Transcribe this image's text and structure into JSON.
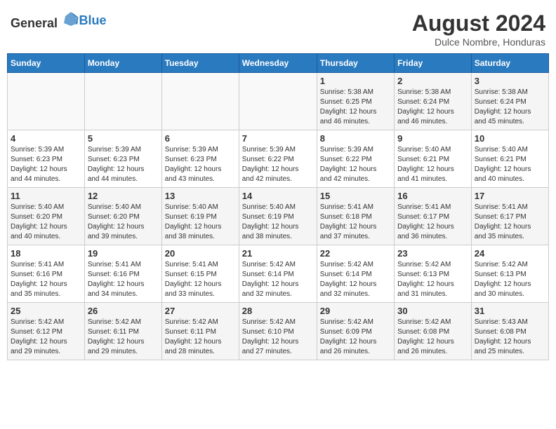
{
  "header": {
    "logo_general": "General",
    "logo_blue": "Blue",
    "month_year": "August 2024",
    "location": "Dulce Nombre, Honduras"
  },
  "days_of_week": [
    "Sunday",
    "Monday",
    "Tuesday",
    "Wednesday",
    "Thursday",
    "Friday",
    "Saturday"
  ],
  "weeks": [
    [
      {
        "day": "",
        "info": ""
      },
      {
        "day": "",
        "info": ""
      },
      {
        "day": "",
        "info": ""
      },
      {
        "day": "",
        "info": ""
      },
      {
        "day": "1",
        "info": "Sunrise: 5:38 AM\nSunset: 6:25 PM\nDaylight: 12 hours\nand 46 minutes."
      },
      {
        "day": "2",
        "info": "Sunrise: 5:38 AM\nSunset: 6:24 PM\nDaylight: 12 hours\nand 46 minutes."
      },
      {
        "day": "3",
        "info": "Sunrise: 5:38 AM\nSunset: 6:24 PM\nDaylight: 12 hours\nand 45 minutes."
      }
    ],
    [
      {
        "day": "4",
        "info": "Sunrise: 5:39 AM\nSunset: 6:23 PM\nDaylight: 12 hours\nand 44 minutes."
      },
      {
        "day": "5",
        "info": "Sunrise: 5:39 AM\nSunset: 6:23 PM\nDaylight: 12 hours\nand 44 minutes."
      },
      {
        "day": "6",
        "info": "Sunrise: 5:39 AM\nSunset: 6:23 PM\nDaylight: 12 hours\nand 43 minutes."
      },
      {
        "day": "7",
        "info": "Sunrise: 5:39 AM\nSunset: 6:22 PM\nDaylight: 12 hours\nand 42 minutes."
      },
      {
        "day": "8",
        "info": "Sunrise: 5:39 AM\nSunset: 6:22 PM\nDaylight: 12 hours\nand 42 minutes."
      },
      {
        "day": "9",
        "info": "Sunrise: 5:40 AM\nSunset: 6:21 PM\nDaylight: 12 hours\nand 41 minutes."
      },
      {
        "day": "10",
        "info": "Sunrise: 5:40 AM\nSunset: 6:21 PM\nDaylight: 12 hours\nand 40 minutes."
      }
    ],
    [
      {
        "day": "11",
        "info": "Sunrise: 5:40 AM\nSunset: 6:20 PM\nDaylight: 12 hours\nand 40 minutes."
      },
      {
        "day": "12",
        "info": "Sunrise: 5:40 AM\nSunset: 6:20 PM\nDaylight: 12 hours\nand 39 minutes."
      },
      {
        "day": "13",
        "info": "Sunrise: 5:40 AM\nSunset: 6:19 PM\nDaylight: 12 hours\nand 38 minutes."
      },
      {
        "day": "14",
        "info": "Sunrise: 5:40 AM\nSunset: 6:19 PM\nDaylight: 12 hours\nand 38 minutes."
      },
      {
        "day": "15",
        "info": "Sunrise: 5:41 AM\nSunset: 6:18 PM\nDaylight: 12 hours\nand 37 minutes."
      },
      {
        "day": "16",
        "info": "Sunrise: 5:41 AM\nSunset: 6:17 PM\nDaylight: 12 hours\nand 36 minutes."
      },
      {
        "day": "17",
        "info": "Sunrise: 5:41 AM\nSunset: 6:17 PM\nDaylight: 12 hours\nand 35 minutes."
      }
    ],
    [
      {
        "day": "18",
        "info": "Sunrise: 5:41 AM\nSunset: 6:16 PM\nDaylight: 12 hours\nand 35 minutes."
      },
      {
        "day": "19",
        "info": "Sunrise: 5:41 AM\nSunset: 6:16 PM\nDaylight: 12 hours\nand 34 minutes."
      },
      {
        "day": "20",
        "info": "Sunrise: 5:41 AM\nSunset: 6:15 PM\nDaylight: 12 hours\nand 33 minutes."
      },
      {
        "day": "21",
        "info": "Sunrise: 5:42 AM\nSunset: 6:14 PM\nDaylight: 12 hours\nand 32 minutes."
      },
      {
        "day": "22",
        "info": "Sunrise: 5:42 AM\nSunset: 6:14 PM\nDaylight: 12 hours\nand 32 minutes."
      },
      {
        "day": "23",
        "info": "Sunrise: 5:42 AM\nSunset: 6:13 PM\nDaylight: 12 hours\nand 31 minutes."
      },
      {
        "day": "24",
        "info": "Sunrise: 5:42 AM\nSunset: 6:13 PM\nDaylight: 12 hours\nand 30 minutes."
      }
    ],
    [
      {
        "day": "25",
        "info": "Sunrise: 5:42 AM\nSunset: 6:12 PM\nDaylight: 12 hours\nand 29 minutes."
      },
      {
        "day": "26",
        "info": "Sunrise: 5:42 AM\nSunset: 6:11 PM\nDaylight: 12 hours\nand 29 minutes."
      },
      {
        "day": "27",
        "info": "Sunrise: 5:42 AM\nSunset: 6:11 PM\nDaylight: 12 hours\nand 28 minutes."
      },
      {
        "day": "28",
        "info": "Sunrise: 5:42 AM\nSunset: 6:10 PM\nDaylight: 12 hours\nand 27 minutes."
      },
      {
        "day": "29",
        "info": "Sunrise: 5:42 AM\nSunset: 6:09 PM\nDaylight: 12 hours\nand 26 minutes."
      },
      {
        "day": "30",
        "info": "Sunrise: 5:42 AM\nSunset: 6:08 PM\nDaylight: 12 hours\nand 26 minutes."
      },
      {
        "day": "31",
        "info": "Sunrise: 5:43 AM\nSunset: 6:08 PM\nDaylight: 12 hours\nand 25 minutes."
      }
    ]
  ]
}
